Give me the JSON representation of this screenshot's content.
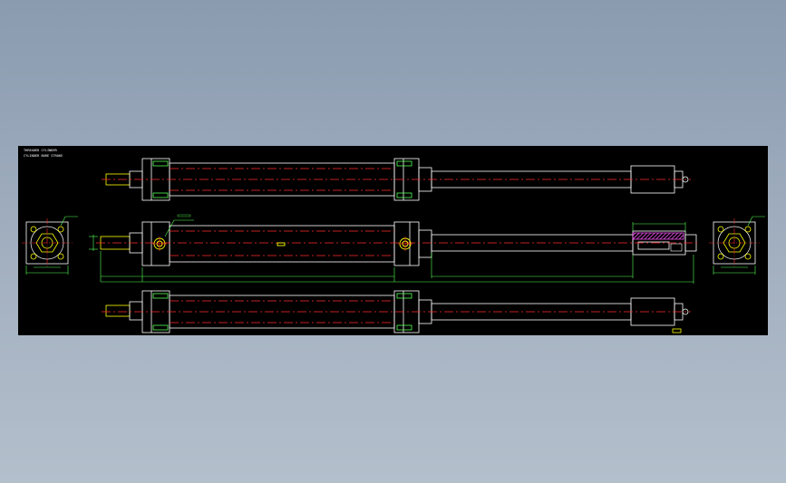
{
  "drawing": {
    "title_line_1": "THREADED CYLINDER",
    "title_line_2": "CYLINDER BORE STROKE"
  },
  "colors": {
    "background": "#000000",
    "outline": "#ffffff",
    "centerline": "#ff2a2a",
    "dimension": "#55ff55",
    "port": "#ffff00",
    "accent": "#ff55ff"
  },
  "views": [
    {
      "name": "top-elevation"
    },
    {
      "name": "front-section"
    },
    {
      "name": "bottom-elevation"
    },
    {
      "name": "left-end-view"
    },
    {
      "name": "right-end-view"
    }
  ]
}
